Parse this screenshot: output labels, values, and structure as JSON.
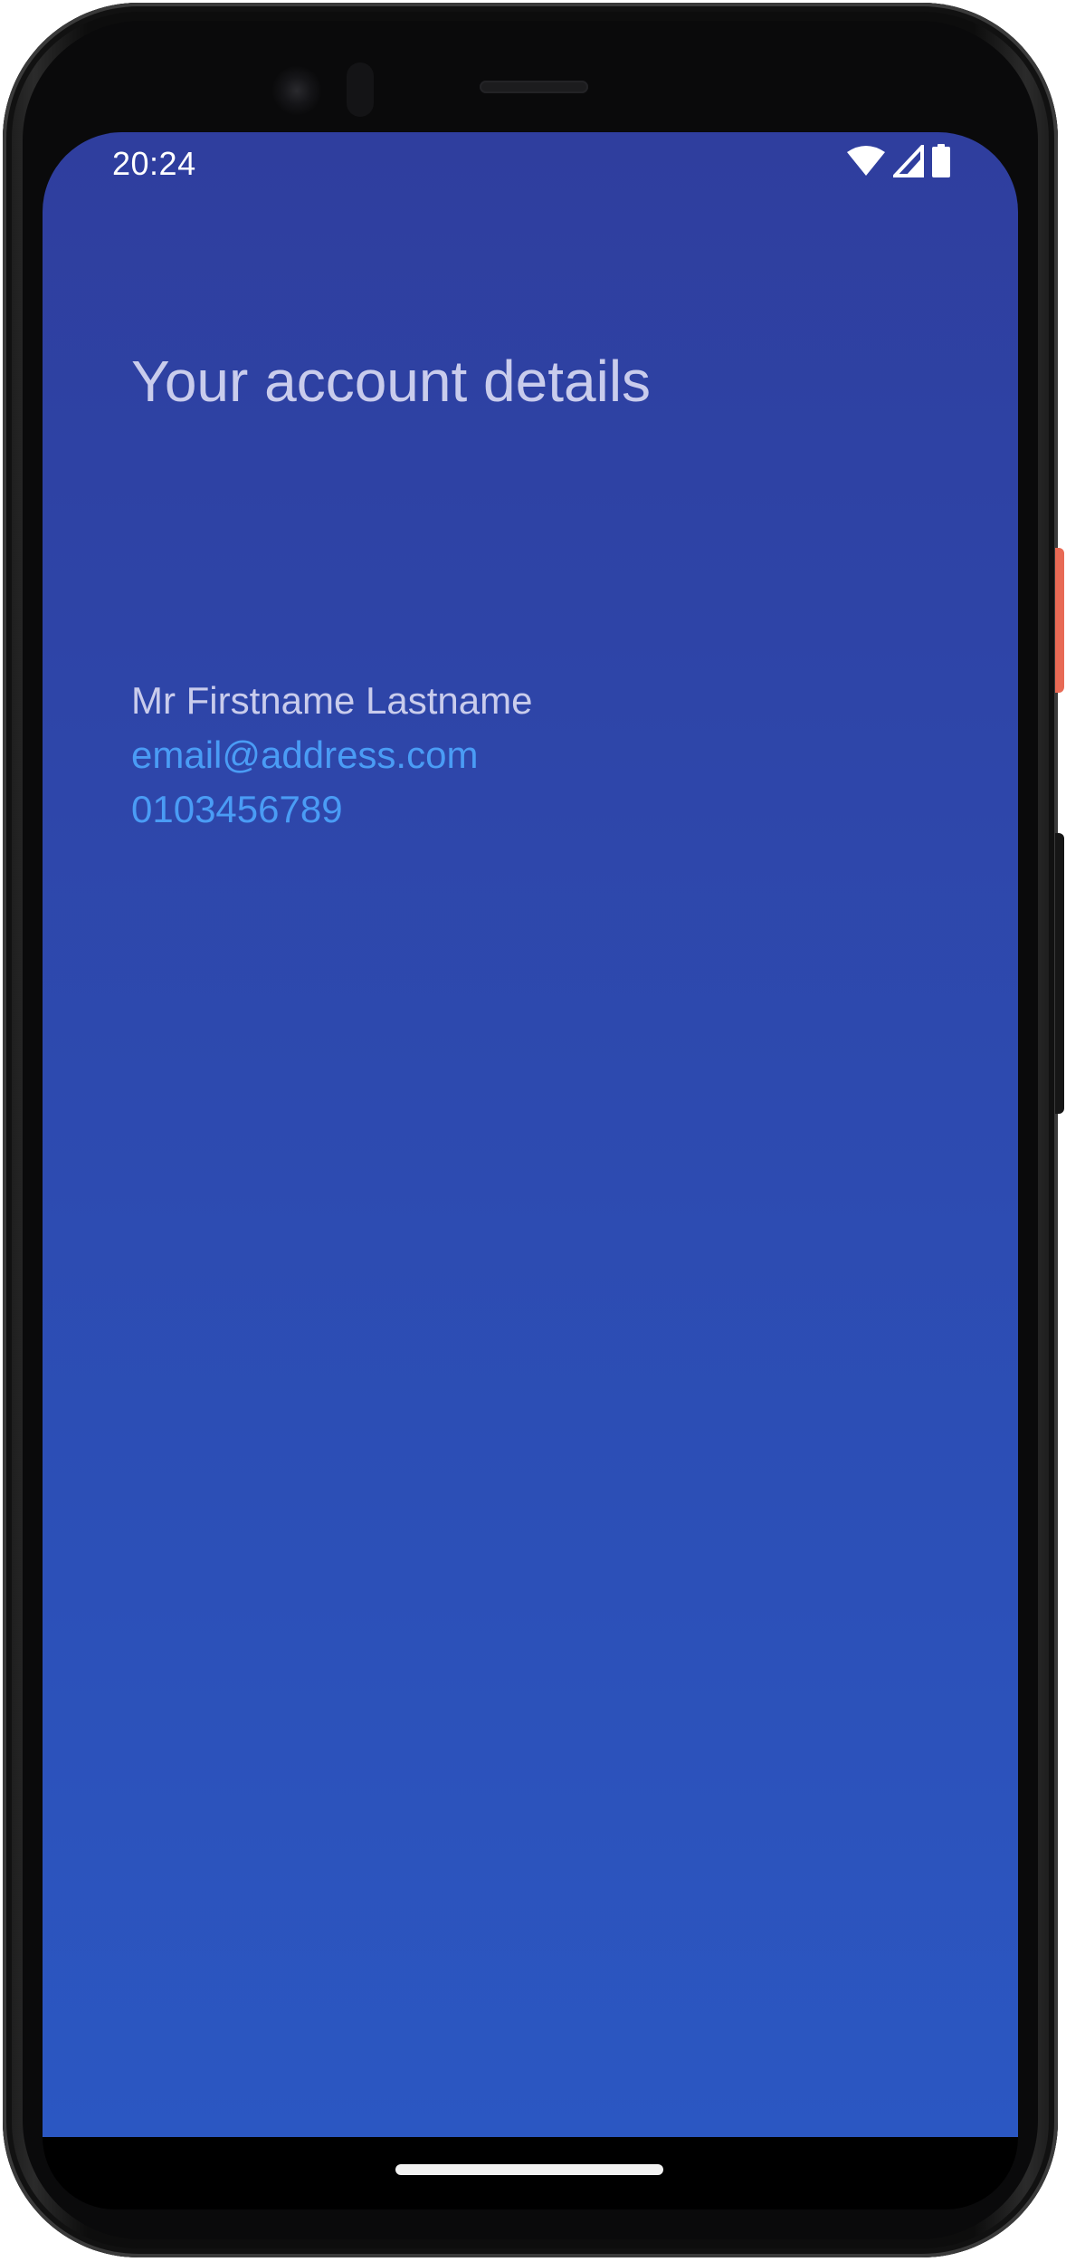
{
  "status_bar": {
    "time": "20:24",
    "icons": [
      "wifi-icon",
      "cell-signal-icon",
      "battery-icon"
    ]
  },
  "account": {
    "title": "Your account details",
    "name": "Mr Firstname Lastname",
    "email": "email@address.com",
    "phone": "0103456789"
  },
  "colors": {
    "background_top": "#2f3e9e",
    "background_bottom": "#2b57c2",
    "text_muted": "#c9ccec",
    "link": "#4a9cf5"
  }
}
